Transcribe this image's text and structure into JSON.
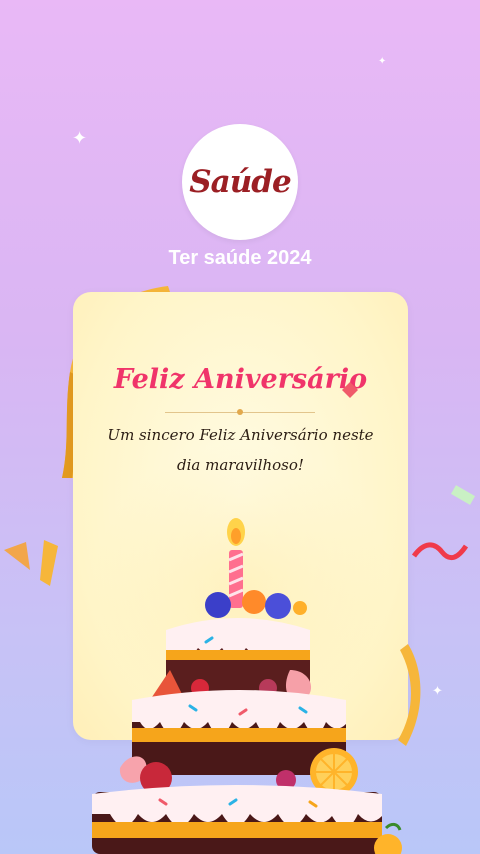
{
  "logo": {
    "text": "Saúde"
  },
  "header": {
    "subtitle": "Ter saúde 2024"
  },
  "card": {
    "title": "Feliz Aniversário",
    "message": "Um sincero Feliz Aniversário neste dia maravilhoso!"
  },
  "colors": {
    "background_top": "#e9b8f6",
    "background_bottom": "#b9c7f8",
    "card": "#fff7cf",
    "title": "#f0346a",
    "logo": "#9b1f24",
    "ribbon": "#f6b63a"
  },
  "icons": {
    "sparkles": "sparkle-icon",
    "cake": "birthday-cake-illustration",
    "ribbon": "ribbon-decoration",
    "confetti": "confetti-decoration"
  }
}
